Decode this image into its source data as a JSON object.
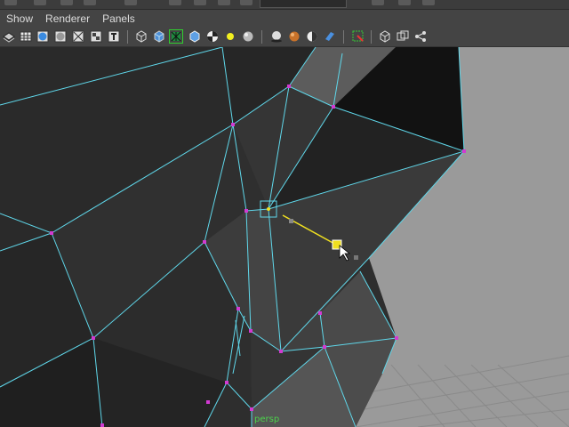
{
  "menubar": {
    "items": [
      "Show",
      "Renderer",
      "Panels"
    ]
  },
  "toolbar": {
    "icons": [
      "layers-icon",
      "wireframe-icon",
      "smooth-shade-icon",
      "flat-shade-icon",
      "bounding-box-icon",
      "texture-icon",
      "wire-cube-icon",
      "shaded-cube-icon",
      "wireframe-on-shaded-icon",
      "cube-outline-icon",
      "checker-icon",
      "light-bulb-icon",
      "gray-sphere-icon",
      "shadow-sphere-icon",
      "orange-sphere-icon",
      "half-sphere-icon",
      "blue-shape-icon",
      "select-frame-icon",
      "isolate-cube-icon",
      "grid-cube-icon",
      "node-graph-icon"
    ]
  },
  "viewport": {
    "camera_label": "persp",
    "colors": {
      "background": "#9a9a9a",
      "edges": "#5fd7ea",
      "vertices": "#d23ad2",
      "manipulator": "#f0e020"
    }
  }
}
